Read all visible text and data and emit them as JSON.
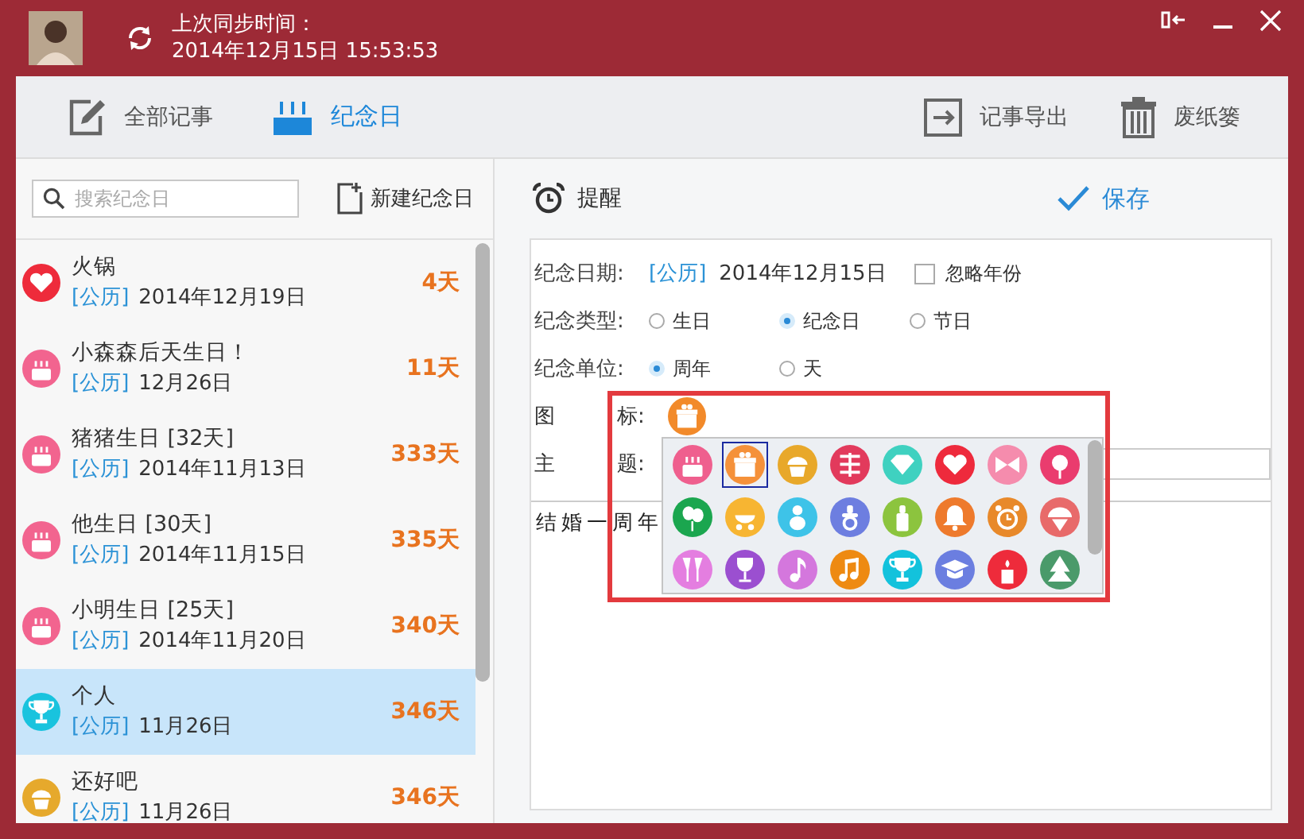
{
  "header": {
    "sync_label": "上次同步时间：",
    "sync_time": "2014年12月15日 15:53:53"
  },
  "tabs": [
    {
      "label": "全部记事",
      "kind": "edit",
      "selected": false
    },
    {
      "label": "纪念日",
      "kind": "cake",
      "selected": true
    }
  ],
  "actions": [
    {
      "label": "记事导出",
      "kind": "export"
    },
    {
      "label": "废纸篓",
      "kind": "trash"
    }
  ],
  "search": {
    "placeholder": "搜索纪念日"
  },
  "new_button": "新建纪念日",
  "list": [
    {
      "title": "火锅",
      "calendar": "[公历]",
      "date": "2014年12月19日",
      "days": "4天",
      "kind": "heart",
      "color": "#ee2b3b",
      "selected": false
    },
    {
      "title": "小森森后天生日！",
      "calendar": "[公历]",
      "date": "12月26日",
      "days": "11天",
      "kind": "cake",
      "color": "#f2648f",
      "selected": false
    },
    {
      "title": "猪猪生日 [32天]",
      "calendar": "[公历]",
      "date": "2014年11月13日",
      "days": "333天",
      "kind": "cake",
      "color": "#f2648f",
      "selected": false
    },
    {
      "title": "他生日 [30天]",
      "calendar": "[公历]",
      "date": "2014年11月15日",
      "days": "335天",
      "kind": "cake",
      "color": "#f2648f",
      "selected": false
    },
    {
      "title": "小明生日 [25天]",
      "calendar": "[公历]",
      "date": "2014年11月20日",
      "days": "340天",
      "kind": "cake",
      "color": "#f2648f",
      "selected": false
    },
    {
      "title": "个人",
      "calendar": "[公历]",
      "date": "11月26日",
      "days": "346天",
      "kind": "trophy",
      "color": "#19c3de",
      "selected": true
    },
    {
      "title": "还好吧",
      "calendar": "[公历]",
      "date": "11月26日",
      "days": "346天",
      "kind": "cupcake",
      "color": "#e6a92c",
      "selected": false
    }
  ],
  "editor": {
    "reminder": "提醒",
    "save": "保存"
  },
  "form": {
    "date": {
      "label": "纪念日期:",
      "calendar": "[公历]",
      "value": "2014年12月15日",
      "ignore_year": {
        "label": "忽略年份",
        "checked": false
      }
    },
    "type": {
      "label": "纪念类型:",
      "options": [
        {
          "label": "生日",
          "selected": false
        },
        {
          "label": "纪念日",
          "selected": true
        },
        {
          "label": "节日",
          "selected": false
        }
      ]
    },
    "unit": {
      "label": "纪念单位:",
      "options": [
        {
          "label": "周年",
          "selected": true
        },
        {
          "label": "天",
          "selected": false
        }
      ]
    },
    "icon": {
      "label_1": "图",
      "label_2": "标:",
      "kind": "gift",
      "color": "#f28a2a"
    },
    "subject": {
      "label_1": "主",
      "label_2": "题:"
    },
    "content": "结婚一周年"
  },
  "icon_picker": [
    {
      "kind": "cake",
      "color": "#ef5f8e",
      "selected": false
    },
    {
      "kind": "gift",
      "color": "#f5913a",
      "selected": true
    },
    {
      "kind": "cupcake",
      "color": "#e8a82a",
      "selected": false
    },
    {
      "kind": "pattern",
      "color": "#e23a5c",
      "selected": false
    },
    {
      "kind": "diamond",
      "color": "#3fd1c0",
      "selected": false
    },
    {
      "kind": "heart",
      "color": "#ee2a3c",
      "selected": false
    },
    {
      "kind": "bow",
      "color": "#f58cad",
      "selected": false
    },
    {
      "kind": "flower",
      "color": "#ea3c6e",
      "selected": false
    },
    {
      "kind": "balloon",
      "color": "#1ba64f",
      "selected": false
    },
    {
      "kind": "stroller",
      "color": "#f7b532",
      "selected": false
    },
    {
      "kind": "baby",
      "color": "#3ec3e8",
      "selected": false
    },
    {
      "kind": "pacifier",
      "color": "#6d7ee0",
      "selected": false
    },
    {
      "kind": "bottle",
      "color": "#8cc43e",
      "selected": false
    },
    {
      "kind": "bell",
      "color": "#ee7a2c",
      "selected": false
    },
    {
      "kind": "alarm-clock",
      "color": "#e8892a",
      "selected": false
    },
    {
      "kind": "ice-cream",
      "color": "#e86a6a",
      "selected": false
    },
    {
      "kind": "glasses",
      "color": "#e47ee0",
      "selected": false
    },
    {
      "kind": "wine",
      "color": "#9b4fd0",
      "selected": false
    },
    {
      "kind": "note",
      "color": "#d477dd",
      "selected": false
    },
    {
      "kind": "music",
      "color": "#ee8a12",
      "selected": false
    },
    {
      "kind": "trophy",
      "color": "#13c2dc",
      "selected": false
    },
    {
      "kind": "cap",
      "color": "#6b7ee0",
      "selected": false
    },
    {
      "kind": "candle",
      "color": "#ee2b3b",
      "selected": false
    },
    {
      "kind": "tree",
      "color": "#4a9a6a",
      "selected": false
    }
  ]
}
